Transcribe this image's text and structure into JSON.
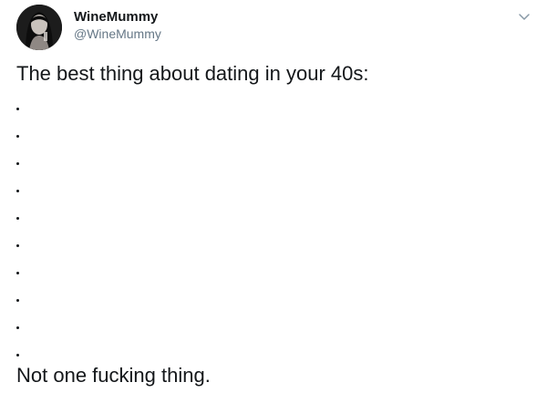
{
  "tweet": {
    "author": {
      "display_name": "WineMummy",
      "handle": "@WineMummy"
    },
    "text": {
      "first_line": "The best thing about dating in your 40s:",
      "dot_count": 10,
      "last_line": "Not one fucking thing."
    },
    "menu_icon": "chevron-down-icon",
    "colors": {
      "text": "#14171a",
      "secondary": "#657786"
    }
  }
}
